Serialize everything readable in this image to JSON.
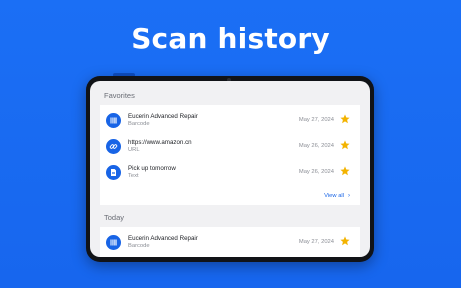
{
  "headline": "Scan history",
  "favorites": {
    "title": "Favorites",
    "items": [
      {
        "title": "Eucerin Advanced Repair",
        "type": "Barcode",
        "date": "May 27, 2024",
        "icon": "barcode-icon"
      },
      {
        "title": "https://www.amazon.cn",
        "type": "URL",
        "date": "May 26, 2024",
        "icon": "link-icon"
      },
      {
        "title": "Pick up tomorrow",
        "type": "Text",
        "date": "May 26, 2024",
        "icon": "document-icon"
      }
    ],
    "view_all": "View all",
    "view_all_icon": "chevron-right-icon"
  },
  "today": {
    "title": "Today",
    "items": [
      {
        "title": "Eucerin Advanced Repair",
        "type": "Barcode",
        "date": "May 27, 2024",
        "icon": "barcode-icon"
      }
    ]
  },
  "colors": {
    "background": "#1a6df4",
    "accent": "#1864e6",
    "star": "#f3b300"
  }
}
